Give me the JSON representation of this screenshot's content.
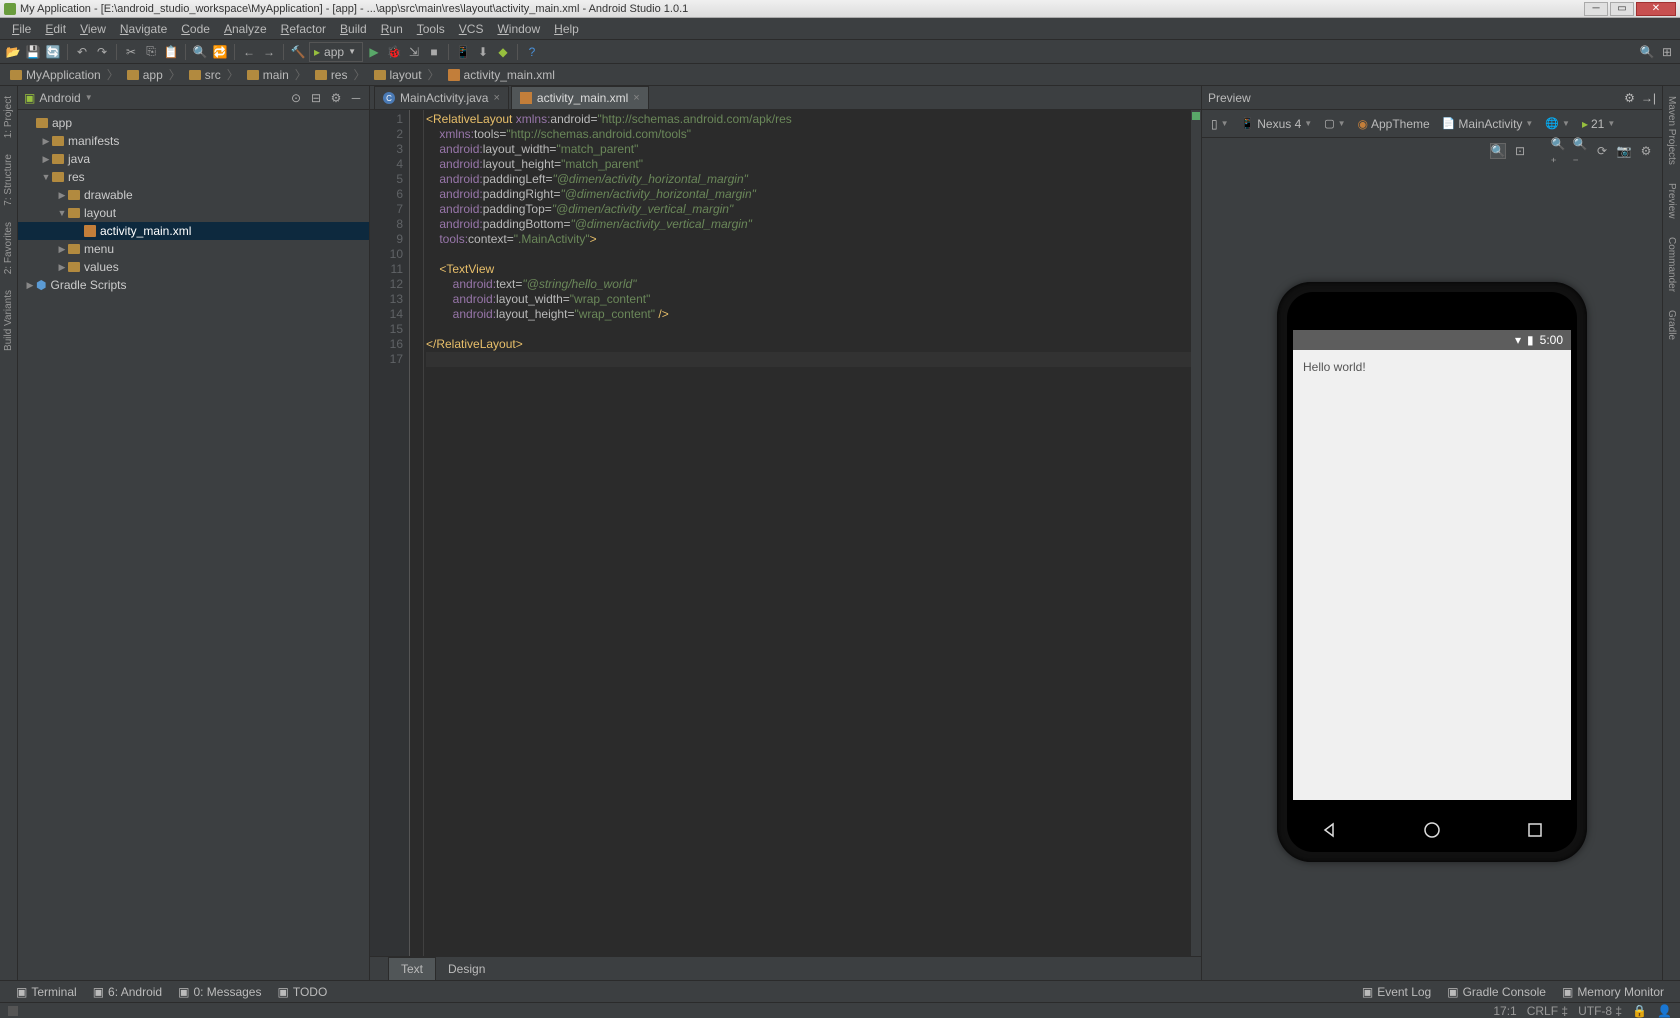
{
  "window": {
    "title": "My Application - [E:\\android_studio_workspace\\MyApplication] - [app] - ...\\app\\src\\main\\res\\layout\\activity_main.xml - Android Studio 1.0.1"
  },
  "menu": [
    "File",
    "Edit",
    "View",
    "Navigate",
    "Code",
    "Analyze",
    "Refactor",
    "Build",
    "Run",
    "Tools",
    "VCS",
    "Window",
    "Help"
  ],
  "run_config": "app",
  "breadcrumbs": [
    {
      "label": "MyApplication",
      "type": "folder"
    },
    {
      "label": "app",
      "type": "folder"
    },
    {
      "label": "src",
      "type": "folder"
    },
    {
      "label": "main",
      "type": "folder"
    },
    {
      "label": "res",
      "type": "folder"
    },
    {
      "label": "layout",
      "type": "folder"
    },
    {
      "label": "activity_main.xml",
      "type": "file"
    }
  ],
  "left_tools": [
    {
      "label": "1: Project"
    },
    {
      "label": "7: Structure"
    },
    {
      "label": "2: Favorites"
    },
    {
      "label": "Build Variants"
    }
  ],
  "right_tools": [
    {
      "label": "Maven Projects"
    },
    {
      "label": "Preview"
    },
    {
      "label": "Commander"
    },
    {
      "label": "Gradle"
    }
  ],
  "project": {
    "view": "Android",
    "tree": [
      {
        "depth": 0,
        "icon": "folder",
        "label": "app",
        "expanded": true
      },
      {
        "depth": 1,
        "icon": "folder",
        "label": "manifests",
        "expanded": false,
        "has_children": true
      },
      {
        "depth": 1,
        "icon": "folder",
        "label": "java",
        "expanded": false,
        "has_children": true
      },
      {
        "depth": 1,
        "icon": "folder-res",
        "label": "res",
        "expanded": true,
        "has_children": true
      },
      {
        "depth": 2,
        "icon": "folder-res",
        "label": "drawable",
        "expanded": false,
        "has_children": true
      },
      {
        "depth": 2,
        "icon": "folder-res",
        "label": "layout",
        "expanded": true,
        "has_children": true
      },
      {
        "depth": 3,
        "icon": "xml",
        "label": "activity_main.xml",
        "selected": true
      },
      {
        "depth": 2,
        "icon": "folder-res",
        "label": "menu",
        "expanded": false,
        "has_children": true
      },
      {
        "depth": 2,
        "icon": "folder-res",
        "label": "values",
        "expanded": false,
        "has_children": true
      },
      {
        "depth": 0,
        "icon": "gradle",
        "label": "Gradle Scripts",
        "expanded": false,
        "has_children": true
      }
    ]
  },
  "editor": {
    "tabs": [
      {
        "label": "MainActivity.java",
        "icon": "java",
        "active": false
      },
      {
        "label": "activity_main.xml",
        "icon": "xml",
        "active": true
      }
    ],
    "bottom_tabs": [
      {
        "label": "Text",
        "active": true
      },
      {
        "label": "Design",
        "active": false
      }
    ],
    "code": {
      "lines": [
        {
          "n": 1,
          "html": "<span class='tok-tag'>&lt;RelativeLayout </span><span class='tok-ns'>xmlns:</span><span class='tok-attr'>android=</span><span class='tok-val'>\"http://schemas.android.com/apk/res</span>"
        },
        {
          "n": 2,
          "html": "    <span class='tok-ns'>xmlns:</span><span class='tok-attr'>tools=</span><span class='tok-val'>\"http://schemas.android.com/tools\"</span>"
        },
        {
          "n": 3,
          "html": "    <span class='tok-ns'>android:</span><span class='tok-attr'>layout_width=</span><span class='tok-val'>\"match_parent\"</span>"
        },
        {
          "n": 4,
          "html": "    <span class='tok-ns'>android:</span><span class='tok-attr'>layout_height=</span><span class='tok-val'>\"match_parent\"</span>"
        },
        {
          "n": 5,
          "html": "    <span class='tok-ns'>android:</span><span class='tok-attr'>paddingLeft=</span><span class='tok-valhl'>\"@dimen/activity_horizontal_margin\"</span>"
        },
        {
          "n": 6,
          "html": "    <span class='tok-ns'>android:</span><span class='tok-attr'>paddingRight=</span><span class='tok-valhl'>\"@dimen/activity_horizontal_margin\"</span>"
        },
        {
          "n": 7,
          "html": "    <span class='tok-ns'>android:</span><span class='tok-attr'>paddingTop=</span><span class='tok-valhl'>\"@dimen/activity_vertical_margin\"</span>"
        },
        {
          "n": 8,
          "html": "    <span class='tok-ns'>android:</span><span class='tok-attr'>paddingBottom=</span><span class='tok-valhl'>\"@dimen/activity_vertical_margin\"</span>"
        },
        {
          "n": 9,
          "html": "    <span class='tok-ns'>tools:</span><span class='tok-attr'>context=</span><span class='tok-val'>\".MainActivity\"</span><span class='tok-tag'>&gt;</span>"
        },
        {
          "n": 10,
          "html": ""
        },
        {
          "n": 11,
          "html": "    <span class='tok-tag'>&lt;TextView</span>"
        },
        {
          "n": 12,
          "html": "        <span class='tok-ns'>android:</span><span class='tok-attr'>text=</span><span class='tok-valhl'>\"@string/hello_world\"</span>"
        },
        {
          "n": 13,
          "html": "        <span class='tok-ns'>android:</span><span class='tok-attr'>layout_width=</span><span class='tok-val'>\"wrap_content\"</span>"
        },
        {
          "n": 14,
          "html": "        <span class='tok-ns'>android:</span><span class='tok-attr'>layout_height=</span><span class='tok-val'>\"wrap_content\"</span> <span class='tok-tag'>/&gt;</span>"
        },
        {
          "n": 15,
          "html": ""
        },
        {
          "n": 16,
          "html": "<span class='tok-tag'>&lt;/RelativeLayout&gt;</span>"
        },
        {
          "n": 17,
          "html": "",
          "cursor": true
        }
      ]
    }
  },
  "preview": {
    "title": "Preview",
    "config": {
      "device": "Nexus 4",
      "theme": "AppTheme",
      "activity": "MainActivity",
      "api": "21"
    },
    "phone": {
      "time": "5:00",
      "content": "Hello world!"
    }
  },
  "statusbar": {
    "left": [
      {
        "label": "Terminal"
      },
      {
        "label": "6: Android"
      },
      {
        "label": "0: Messages"
      },
      {
        "label": "TODO"
      }
    ],
    "right": [
      {
        "label": "Event Log"
      },
      {
        "label": "Gradle Console"
      },
      {
        "label": "Memory Monitor"
      }
    ]
  },
  "footer": {
    "pos": "17:1",
    "eol": "CRLF",
    "enc": "UTF-8"
  }
}
